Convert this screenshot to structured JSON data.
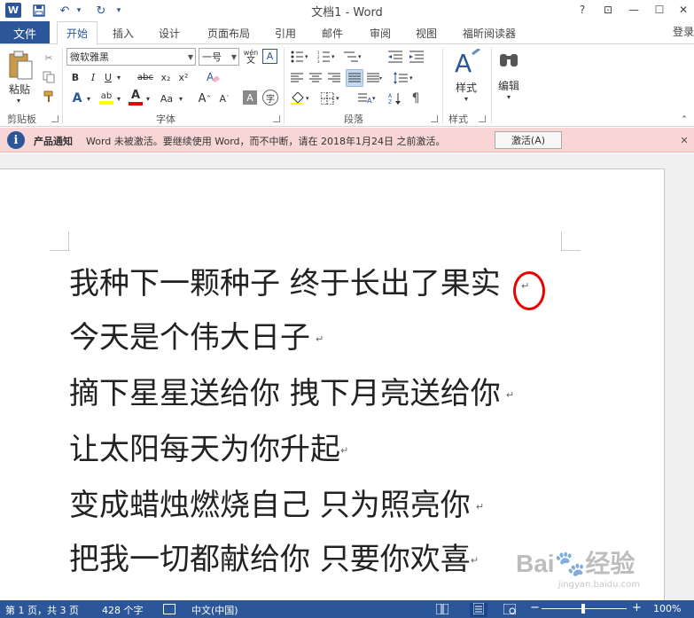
{
  "window": {
    "title": "文档1 - Word",
    "help": "?",
    "restore": "⊡",
    "minimize": "—",
    "maximize": "☐",
    "close": "✕"
  },
  "quick_access": {
    "logo": "W",
    "save": "💾",
    "undo": "↶",
    "undo_arrow": "▾",
    "redo": "↻",
    "customize": "▾"
  },
  "tabs": {
    "file": "文件",
    "items": [
      "开始",
      "插入",
      "设计",
      "页面布局",
      "引用",
      "邮件",
      "审阅",
      "视图",
      "福昕阅读器"
    ],
    "login": "登录"
  },
  "ribbon": {
    "clipboard": {
      "paste": "粘贴",
      "label": "剪贴板"
    },
    "font": {
      "name": "微软雅黑",
      "size": "一号",
      "wen": "wén",
      "label": "字体",
      "bold": "B",
      "italic": "I",
      "underline": "U",
      "strike": "abc",
      "subscript": "x₂",
      "superscript": "x²",
      "grow": "A",
      "shrink": "A",
      "case": "Aa"
    },
    "paragraph": {
      "label": "段落"
    },
    "styles": {
      "button": "样式",
      "label": "样式"
    },
    "editing": {
      "button": "编辑"
    }
  },
  "message_bar": {
    "title": "产品通知",
    "text": "Word 未被激活。要继续使用 Word，而不中断，请在 2018年1月24日 之前激活。",
    "button": "激活(A)",
    "close": "✕"
  },
  "document": {
    "lines": [
      "我种下一颗种子  终于长出了果实",
      "今天是个伟大日子",
      "摘下星星送给你  拽下月亮送给你",
      "让太阳每天为你升起",
      "变成蜡烛燃烧自己  只为照亮你",
      "把我一切都献给你  只要你欢喜"
    ],
    "mark": "↵"
  },
  "status_bar": {
    "page": "第 1 页，共 3 页",
    "words": "428 个字",
    "language": "中文(中国)",
    "zoom_minus": "−",
    "zoom_plus": "+",
    "zoom": "100%",
    "zoom_level": 1.0
  },
  "watermark": {
    "brand": "Bai🐾经验",
    "url": "jingyan.baidu.com"
  }
}
